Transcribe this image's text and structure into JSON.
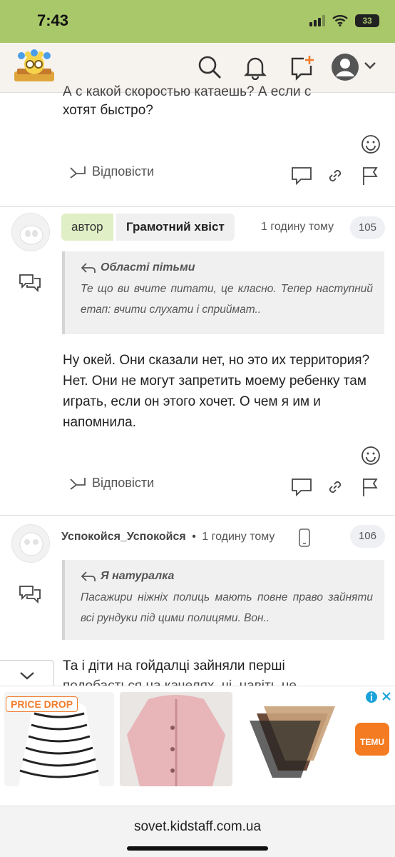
{
  "status": {
    "time": "7:43",
    "battery": "33"
  },
  "post_tail": {
    "text_partial": "А с какой скоростью катаешь? А если с",
    "text": "хотят быстро?",
    "reply_label": "Відповісти"
  },
  "comments": [
    {
      "badge": "автор",
      "author": "Грамотний хвіст",
      "time": "1 годину тому",
      "number": "105",
      "quote_author": "Області пітьми",
      "quote_text": "Те що ви вчите питати, це класно. Тепер наступний етап: вчити слухати і сприймат..",
      "text": "Ну окей. Они сказали нет, но это их территория? Нет. Они не могут запретить моему ребенку там играть, если он этого хочет. О чем я им и напомнила.",
      "reply_label": "Відповісти"
    },
    {
      "author": "Успокойся_Успокойся",
      "separator": "•",
      "time": "1 годину тому",
      "number": "106",
      "quote_author": "Я натуралка",
      "quote_text": "Пасажири ніжніх полиць мають повне право зайняти всі рундуки під цими полицями. Вон..",
      "text": "Та і діти на гойдалці зайняли перші",
      "text_partial": "подобається на качелях, чі, навіть не"
    }
  ],
  "ad": {
    "price_drop": "PRICE DROP",
    "brand": "TEMU"
  },
  "browser": {
    "url": "sovet.kidstaff.com.ua"
  },
  "colors": {
    "statusbar": "#a9c86a",
    "author_badge": "#e0efc6"
  }
}
